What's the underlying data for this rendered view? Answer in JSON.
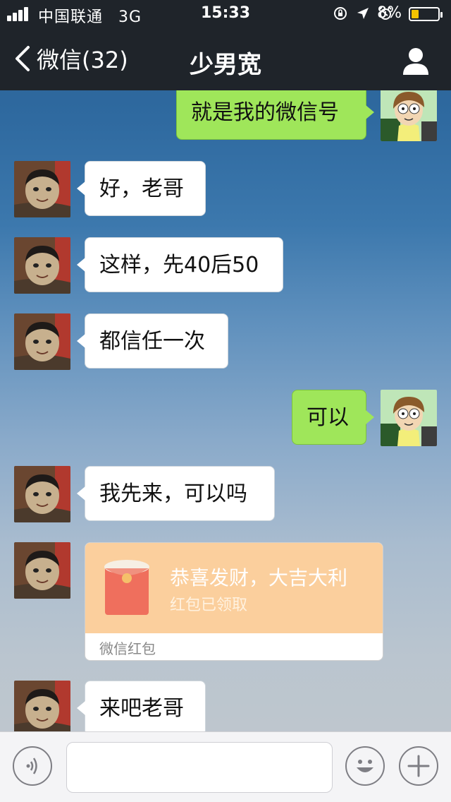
{
  "status_bar": {
    "carrier": "中国联通",
    "network": "3G",
    "time": "15:33",
    "battery_percent": "8%",
    "battery_color": "#f5c400"
  },
  "nav": {
    "back_label": "微信(32)",
    "title": "少男宽",
    "profile_icon": "person-icon"
  },
  "colors": {
    "nav_bg": "#1f242a",
    "incoming_bubble": "#ffffff",
    "outgoing_bubble": "#9fe65a",
    "red_packet_bg": "#fbcf9d",
    "red_packet_envelope": "#ef6f5d"
  },
  "messages": [
    {
      "side": "right",
      "text": "就是我的微信号"
    },
    {
      "side": "left",
      "text": "好，老哥"
    },
    {
      "side": "left",
      "text": "这样，先40后50"
    },
    {
      "side": "left",
      "text": "都信任一次"
    },
    {
      "side": "right",
      "text": "可以"
    },
    {
      "side": "left",
      "text": "我先来，可以吗"
    },
    {
      "side": "left",
      "type": "red_packet",
      "title": "恭喜发财，大吉大利",
      "status": "红包已领取",
      "footer": "微信红包"
    },
    {
      "side": "left",
      "text": "来吧老哥"
    }
  ],
  "input_bar": {
    "voice_icon": "voice-icon",
    "emoji_icon": "emoji-icon",
    "plus_icon": "plus-icon",
    "text_value": ""
  }
}
